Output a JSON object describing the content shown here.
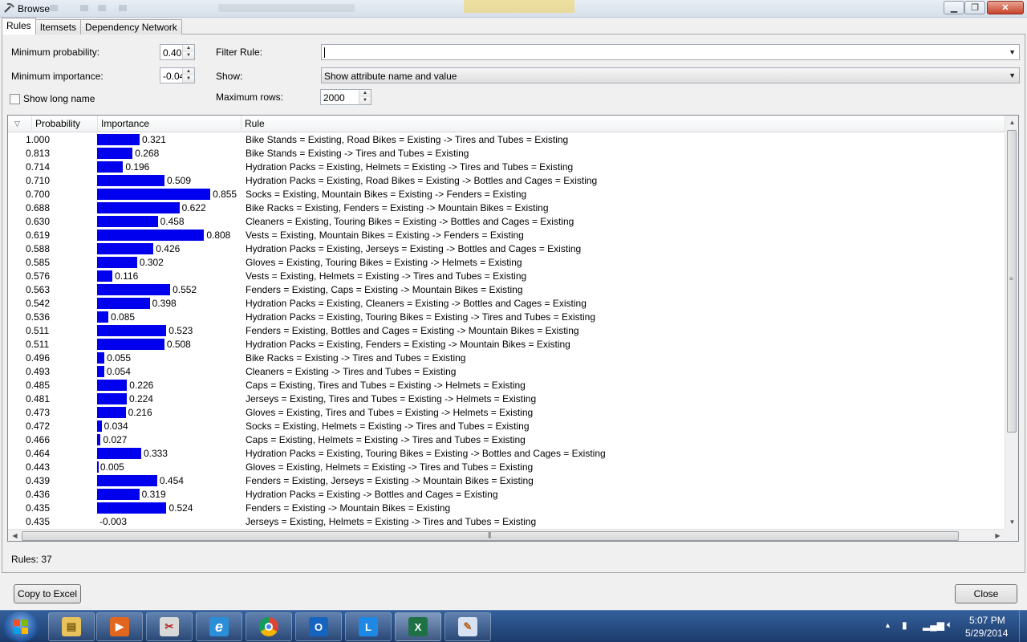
{
  "window": {
    "title": "Browse",
    "minimize_glyph": "▁",
    "maximize_glyph": "❐",
    "close_glyph": "✕"
  },
  "tabs": [
    {
      "label": "Rules",
      "active": true
    },
    {
      "label": "Itemsets",
      "active": false
    },
    {
      "label": "Dependency Network",
      "active": false
    }
  ],
  "controls": {
    "min_probability_label": "Minimum probability:",
    "min_probability_value": "0.40",
    "min_importance_label": "Minimum importance:",
    "min_importance_value": "-0.04",
    "show_long_name_label": "Show long name",
    "show_long_name_checked": false,
    "filter_rule_label": "Filter Rule:",
    "filter_rule_value": "",
    "show_label": "Show:",
    "show_value": "Show attribute name and value",
    "max_rows_label": "Maximum rows:",
    "max_rows_value": "2000"
  },
  "grid": {
    "columns": [
      "Probability",
      "Importance",
      "Rule"
    ],
    "sort_glyph": "▽",
    "rows": [
      {
        "probability": "1.000",
        "importance": 0.321,
        "importance_text": "0.321",
        "rule": "Bike Stands = Existing, Road Bikes = Existing -> Tires and Tubes = Existing"
      },
      {
        "probability": "0.813",
        "importance": 0.268,
        "importance_text": "0.268",
        "rule": "Bike Stands = Existing -> Tires and Tubes = Existing"
      },
      {
        "probability": "0.714",
        "importance": 0.196,
        "importance_text": "0.196",
        "rule": "Hydration Packs = Existing, Helmets = Existing -> Tires and Tubes = Existing"
      },
      {
        "probability": "0.710",
        "importance": 0.509,
        "importance_text": "0.509",
        "rule": "Hydration Packs = Existing, Road Bikes = Existing -> Bottles and Cages = Existing"
      },
      {
        "probability": "0.700",
        "importance": 0.855,
        "importance_text": "0.855",
        "rule": "Socks = Existing, Mountain Bikes = Existing -> Fenders = Existing"
      },
      {
        "probability": "0.688",
        "importance": 0.622,
        "importance_text": "0.622",
        "rule": "Bike Racks = Existing, Fenders = Existing -> Mountain Bikes = Existing"
      },
      {
        "probability": "0.630",
        "importance": 0.458,
        "importance_text": "0.458",
        "rule": "Cleaners = Existing, Touring Bikes = Existing -> Bottles and Cages = Existing"
      },
      {
        "probability": "0.619",
        "importance": 0.808,
        "importance_text": "0.808",
        "rule": "Vests = Existing, Mountain Bikes = Existing -> Fenders = Existing"
      },
      {
        "probability": "0.588",
        "importance": 0.426,
        "importance_text": "0.426",
        "rule": "Hydration Packs = Existing, Jerseys = Existing -> Bottles and Cages = Existing"
      },
      {
        "probability": "0.585",
        "importance": 0.302,
        "importance_text": "0.302",
        "rule": "Gloves = Existing, Touring Bikes = Existing -> Helmets = Existing"
      },
      {
        "probability": "0.576",
        "importance": 0.116,
        "importance_text": "0.116",
        "rule": "Vests = Existing, Helmets = Existing -> Tires and Tubes = Existing"
      },
      {
        "probability": "0.563",
        "importance": 0.552,
        "importance_text": "0.552",
        "rule": "Fenders = Existing, Caps = Existing -> Mountain Bikes = Existing"
      },
      {
        "probability": "0.542",
        "importance": 0.398,
        "importance_text": "0.398",
        "rule": "Hydration Packs = Existing, Cleaners = Existing -> Bottles and Cages = Existing"
      },
      {
        "probability": "0.536",
        "importance": 0.085,
        "importance_text": "0.085",
        "rule": "Hydration Packs = Existing, Touring Bikes = Existing -> Tires and Tubes = Existing"
      },
      {
        "probability": "0.511",
        "importance": 0.523,
        "importance_text": "0.523",
        "rule": "Fenders = Existing, Bottles and Cages = Existing -> Mountain Bikes = Existing"
      },
      {
        "probability": "0.511",
        "importance": 0.508,
        "importance_text": "0.508",
        "rule": "Hydration Packs = Existing, Fenders = Existing -> Mountain Bikes = Existing"
      },
      {
        "probability": "0.496",
        "importance": 0.055,
        "importance_text": "0.055",
        "rule": "Bike Racks = Existing -> Tires and Tubes = Existing"
      },
      {
        "probability": "0.493",
        "importance": 0.054,
        "importance_text": "0.054",
        "rule": "Cleaners = Existing -> Tires and Tubes = Existing"
      },
      {
        "probability": "0.485",
        "importance": 0.226,
        "importance_text": "0.226",
        "rule": "Caps = Existing, Tires and Tubes = Existing -> Helmets = Existing"
      },
      {
        "probability": "0.481",
        "importance": 0.224,
        "importance_text": "0.224",
        "rule": "Jerseys = Existing, Tires and Tubes = Existing -> Helmets = Existing"
      },
      {
        "probability": "0.473",
        "importance": 0.216,
        "importance_text": "0.216",
        "rule": "Gloves = Existing, Tires and Tubes = Existing -> Helmets = Existing"
      },
      {
        "probability": "0.472",
        "importance": 0.034,
        "importance_text": "0.034",
        "rule": "Socks = Existing, Helmets = Existing -> Tires and Tubes = Existing"
      },
      {
        "probability": "0.466",
        "importance": 0.027,
        "importance_text": "0.027",
        "rule": "Caps = Existing, Helmets = Existing -> Tires and Tubes = Existing"
      },
      {
        "probability": "0.464",
        "importance": 0.333,
        "importance_text": "0.333",
        "rule": "Hydration Packs = Existing, Touring Bikes = Existing -> Bottles and Cages = Existing"
      },
      {
        "probability": "0.443",
        "importance": 0.005,
        "importance_text": "0.005",
        "rule": "Gloves = Existing, Helmets = Existing -> Tires and Tubes = Existing"
      },
      {
        "probability": "0.439",
        "importance": 0.454,
        "importance_text": "0.454",
        "rule": "Fenders = Existing, Jerseys = Existing -> Mountain Bikes = Existing"
      },
      {
        "probability": "0.436",
        "importance": 0.319,
        "importance_text": "0.319",
        "rule": "Hydration Packs = Existing -> Bottles and Cages = Existing"
      },
      {
        "probability": "0.435",
        "importance": 0.524,
        "importance_text": "0.524",
        "rule": "Fenders = Existing -> Mountain Bikes = Existing"
      },
      {
        "probability": "0.435",
        "importance": -0.003,
        "importance_text": "-0.003",
        "rule": "Jerseys = Existing, Helmets = Existing -> Tires and Tubes = Existing"
      }
    ]
  },
  "status": {
    "rules_count": "Rules: 37"
  },
  "buttons": {
    "copy_to_excel": "Copy to Excel",
    "close": "Close"
  },
  "taskbar": {
    "apps": [
      "file-explorer",
      "media-player",
      "paint-tools",
      "internet-explorer",
      "chrome",
      "outlook",
      "lync",
      "excel",
      "paint"
    ],
    "time": "5:07 PM",
    "date": "5/29/2014"
  },
  "colors": {
    "importance_bar": "#0000ee"
  }
}
